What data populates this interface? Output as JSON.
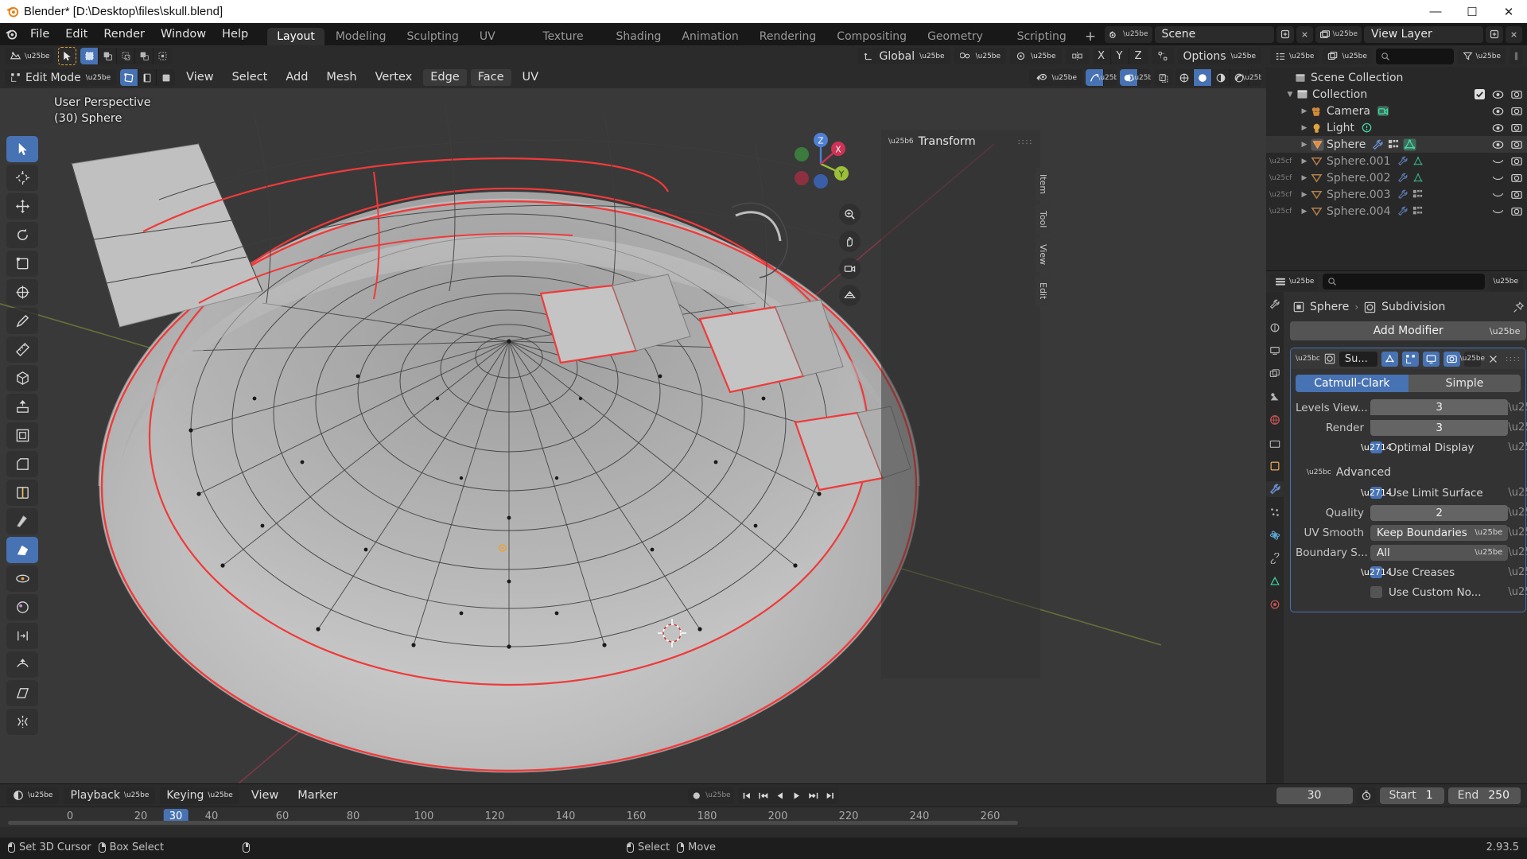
{
  "window": {
    "title": "Blender* [D:\\Desktop\\files\\skull.blend]",
    "minimize": "—",
    "maximize": "☐",
    "close": "✕"
  },
  "topbar": {
    "menus": [
      "File",
      "Edit",
      "Render",
      "Window",
      "Help"
    ],
    "workspaces": [
      {
        "label": "Layout",
        "active": true
      },
      {
        "label": "Modeling",
        "active": false
      },
      {
        "label": "Sculpting",
        "active": false
      },
      {
        "label": "UV Editing",
        "active": false
      },
      {
        "label": "Texture Paint",
        "active": false
      },
      {
        "label": "Shading",
        "active": false
      },
      {
        "label": "Animation",
        "active": false
      },
      {
        "label": "Rendering",
        "active": false
      },
      {
        "label": "Compositing",
        "active": false
      },
      {
        "label": "Geometry Nodes",
        "active": false
      },
      {
        "label": "Scripting",
        "active": false
      }
    ],
    "add_workspace": "+",
    "scene_name": "Scene",
    "view_layer_name": "View Layer"
  },
  "viewport_header_row1": {
    "transform_orientation": "Global",
    "axis_x": "X",
    "axis_y": "Y",
    "axis_z": "Z",
    "options_label": "Options"
  },
  "viewport_header_row2": {
    "mode": "Edit Mode",
    "menus": [
      "View",
      "Select",
      "Add",
      "Mesh",
      "Vertex",
      "Edge",
      "Face",
      "UV"
    ],
    "select_modes": [
      "vertex-select",
      "edge-select",
      "face-select"
    ],
    "active_select_mode": 0
  },
  "viewport": {
    "perspective_label": "User Perspective",
    "object_label": "(30) Sphere",
    "background": "#393939",
    "gizmo_axes": {
      "x": "X",
      "y": "Y",
      "z": "Z"
    },
    "colors": {
      "axis_x": "#cc3355",
      "axis_y": "#9bbf3b",
      "axis_z": "#4f7fd5",
      "selected_edge": "#f04040",
      "mesh_surface": "#b9b9b9",
      "wireframe": "#3a3a3a"
    }
  },
  "npanel": {
    "title": "Transform",
    "tabs": [
      "Item",
      "Tool",
      "View",
      "Edit"
    ]
  },
  "toolbar_tools": [
    "tweak-select-tool",
    "cursor-tool",
    "move-tool",
    "rotate-tool",
    "scale-tool",
    "transform-tool",
    "annotate-tool",
    "measure-tool",
    "add-cube-tool",
    "extrude-region-tool",
    "inset-faces-tool",
    "bevel-tool",
    "loop-cut-tool",
    "knife-tool",
    "poly-build-tool",
    "spin-tool",
    "smooth-tool",
    "edge-slide-tool",
    "shrink-fatten-tool",
    "shear-tool",
    "rip-region-tool"
  ],
  "outliner": {
    "display_mode_icon": "outliner-mode-icon",
    "filter_icon": "filter-icon",
    "search_placeholder": "",
    "rows": [
      {
        "label": "Scene Collection",
        "icon": "collection-icon",
        "indent": 0,
        "arrow": "",
        "selected": false,
        "dim": false,
        "checkbox": false,
        "eye": false,
        "camera": false,
        "mods": []
      },
      {
        "label": "Collection",
        "icon": "collection-icon",
        "indent": 1,
        "arrow": "▼",
        "selected": false,
        "dim": false,
        "checkbox": true,
        "eye": true,
        "camera": true,
        "mods": []
      },
      {
        "label": "Camera",
        "icon": "camera-object-icon",
        "indent": 2,
        "arrow": "▶",
        "selected": false,
        "dim": false,
        "checkbox": false,
        "eye": true,
        "camera": true,
        "mods": [
          "camera-data-icon"
        ]
      },
      {
        "label": "Light",
        "icon": "light-object-icon",
        "indent": 2,
        "arrow": "▶",
        "selected": false,
        "dim": false,
        "checkbox": false,
        "eye": true,
        "camera": true,
        "mods": [
          "light-data-icon"
        ]
      },
      {
        "label": "Sphere",
        "icon": "mesh-object-icon",
        "indent": 2,
        "arrow": "▶",
        "selected": true,
        "dim": false,
        "checkbox": false,
        "eye": true,
        "camera": true,
        "mods": [
          "wrench-icon",
          "modifier-icon",
          "mesh-data-icon"
        ]
      },
      {
        "label": "Sphere.001",
        "icon": "mesh-object-icon",
        "indent": 2,
        "arrow": "▶",
        "selected": false,
        "dim": true,
        "checkbox": false,
        "eye": false,
        "camera": true,
        "mods": [
          "wrench-icon",
          "mesh-data-icon"
        ]
      },
      {
        "label": "Sphere.002",
        "icon": "mesh-object-icon",
        "indent": 2,
        "arrow": "▶",
        "selected": false,
        "dim": true,
        "checkbox": false,
        "eye": false,
        "camera": true,
        "mods": [
          "wrench-icon",
          "mesh-data-icon"
        ]
      },
      {
        "label": "Sphere.003",
        "icon": "mesh-object-icon",
        "indent": 2,
        "arrow": "▶",
        "selected": false,
        "dim": true,
        "checkbox": false,
        "eye": false,
        "camera": true,
        "mods": [
          "wrench-icon",
          "modifier-icon"
        ]
      },
      {
        "label": "Sphere.004",
        "icon": "mesh-object-icon",
        "indent": 2,
        "arrow": "▶",
        "selected": false,
        "dim": true,
        "checkbox": false,
        "eye": false,
        "camera": true,
        "mods": [
          "wrench-icon",
          "modifier-icon"
        ]
      }
    ]
  },
  "properties": {
    "search_placeholder": "",
    "breadcrumb": {
      "object": "Sphere",
      "separator": "›",
      "modifier": "Subdivision"
    },
    "add_modifier": "Add Modifier",
    "modifier": {
      "name_field": "Su...",
      "type_buttons": [
        "on-cage",
        "edit-mode",
        "realtime",
        "render"
      ],
      "subdivision_type": [
        "Catmull-Clark",
        "Simple"
      ],
      "active_subdivision_type": 0,
      "fields": [
        {
          "label": "Levels View...",
          "value": "3",
          "type": "number"
        },
        {
          "label": "Render",
          "value": "3",
          "type": "number"
        }
      ],
      "optimal_display": {
        "label": "Optimal Display",
        "checked": true
      },
      "advanced_label": "Advanced",
      "advanced": [
        {
          "label": "Use Limit Surface",
          "checked": true,
          "type": "check"
        },
        {
          "label": "Quality",
          "value": "2",
          "type": "number"
        },
        {
          "label": "UV Smooth",
          "value": "Keep Boundaries",
          "type": "dropdown"
        },
        {
          "label": "Boundary S...",
          "value": "All",
          "type": "dropdown"
        },
        {
          "label": "Use Creases",
          "checked": true,
          "type": "check"
        },
        {
          "label": "Use Custom No...",
          "checked": false,
          "type": "check"
        }
      ]
    },
    "tabs": [
      "tool-tab",
      "render-tab",
      "output-tab",
      "view-layer-tab",
      "scene-tab",
      "world-tab",
      "collection-tab",
      "object-tab",
      "modifier-tab",
      "particles-tab",
      "physics-tab",
      "constraints-tab",
      "data-tab",
      "material-tab"
    ],
    "active_tab_index": 8
  },
  "timeline": {
    "editor_icon": "timeline-editor-icon",
    "menus": [
      "Playback",
      "Keying",
      "View",
      "Marker"
    ],
    "auto_keying_icon": "record-icon",
    "transport": [
      "jump-start",
      "prev-keyframe",
      "play-reverse",
      "play",
      "next-keyframe",
      "jump-end"
    ],
    "current_frame": "30",
    "timer_icon": "use-preview-range-icon",
    "start_label": "Start",
    "start_value": "1",
    "end_label": "End",
    "end_value": "250",
    "ticks": [
      "0",
      "20",
      "30",
      "40",
      "60",
      "80",
      "100",
      "120",
      "140",
      "160",
      "180",
      "200",
      "220",
      "240",
      "260"
    ],
    "playhead_frame": "30"
  },
  "statusbar": {
    "items": [
      {
        "mouse": "left",
        "label": "Set 3D Cursor"
      },
      {
        "mouse": "right",
        "label": "Box Select"
      },
      {
        "mouse": "middle",
        "label": ""
      },
      {
        "mouse": "left",
        "label": "Select"
      },
      {
        "mouse": "right",
        "label": "Move"
      }
    ],
    "version": "2.93.5"
  }
}
